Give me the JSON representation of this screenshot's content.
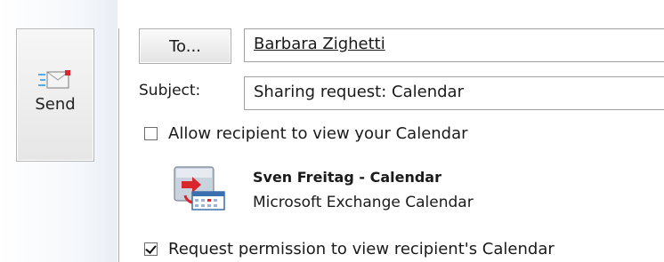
{
  "send_button": {
    "label": "Send",
    "icon": "send-envelope-icon"
  },
  "to_button": {
    "label": "To..."
  },
  "to_field": {
    "value": "Barbara Zighetti"
  },
  "subject": {
    "label": "Subject:",
    "value": "Sharing request: Calendar"
  },
  "allow_checkbox": {
    "label": "Allow recipient to view your Calendar",
    "checked": false
  },
  "shared_calendar": {
    "icon": "calendar-sharing-icon",
    "title": "Sven Freitag - Calendar",
    "subtitle": "Microsoft Exchange Calendar"
  },
  "request_checkbox": {
    "label": "Request permission to view recipient's Calendar",
    "checked": true
  },
  "colors": {
    "divider": "#9fb0c6",
    "button_border": "#b7b7b7",
    "field_border": "#a0a0a0"
  }
}
